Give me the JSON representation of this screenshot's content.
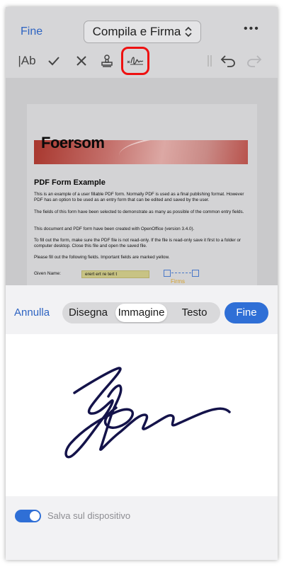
{
  "header": {
    "fine_label": "Fine",
    "title": "Compila e Firma",
    "more": "•••"
  },
  "toolbar": {
    "text_tool": "|Ab"
  },
  "pdf": {
    "brand": "Foersom",
    "heading": "PDF Form Example",
    "paragraphs": [
      "This is an example of a user fillable PDF form. Normally PDF is used as a final publishing format. However PDF has an option to be used as an entry form that can be edited and saved by the user.",
      "The fields of this form have been selected to demonstrate as many as possible of the common entry fields.",
      "This document and PDF form have been created with OpenOffice (version 3.4.0).",
      "To fill out the form, make sure the PDF file is not read-only. If the file is read-only save it first to a folder or computer desktop. Close this file and open the saved file.",
      "Please fill out the following fields. Important fields are marked yellow."
    ],
    "given_name_label": "Given Name:",
    "given_name_value": "erert ert re tert t",
    "firms_label": "Firms"
  },
  "panel": {
    "cancel_label": "Annulla",
    "tabs": [
      "Disegna",
      "Immagine",
      "Testo"
    ],
    "active_tab": "Immagine",
    "done_label": "Fine",
    "save_label": "Salva sul dispositivo",
    "save_enabled": true
  },
  "colors": {
    "accent": "#2f6fd6",
    "link": "#2e64c2",
    "selection": "#e11111",
    "ink": "#14134a"
  },
  "icons": [
    "text-tool-icon",
    "check-icon",
    "cross-icon",
    "stamp-icon",
    "signature-icon",
    "divider-icon",
    "undo-icon",
    "redo-icon"
  ]
}
